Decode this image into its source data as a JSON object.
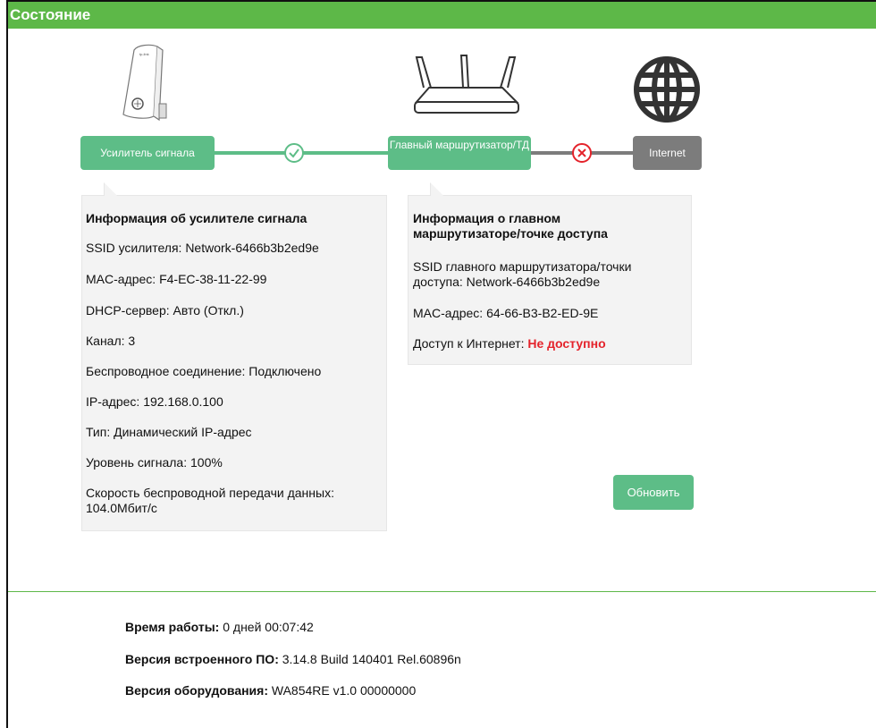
{
  "header": {
    "title": "Состояние"
  },
  "diagram": {
    "extender_label": "Усилитель сигнала",
    "router_label": "Главный маршрутизатор/ТД",
    "internet_label": "Internet",
    "link1_status_icon": "check-circle-icon",
    "link2_status_icon": "x-circle-icon",
    "colors": {
      "green": "#5dbd87",
      "gray": "#7c7c7c",
      "red": "#e4232b",
      "header": "#5db848"
    }
  },
  "extender": {
    "title": "Информация об усилителе сигнала",
    "ssid": "SSID усилителя: Network-6466b3b2ed9e",
    "mac": "MAC-адрес: F4-EC-38-11-22-99",
    "dhcp": "DHCP-сервер: Авто (Откл.)",
    "channel": "Канал: 3",
    "wireless": "Беспроводное соединение: Подключено",
    "ip": "IP-адрес: 192.168.0.100",
    "type": "Тип: Динамический IP-адрес",
    "signal": "Уровень сигнала: 100%",
    "speed_line1": "Скорость беспроводной передачи данных:",
    "speed_line2": "104.0Мбит/с"
  },
  "router": {
    "title_line1": "Информация о главном",
    "title_line2": "маршрутизаторе/точке доступа",
    "ssid_line1": "SSID главного маршрутизатора/точки",
    "ssid_line2": "доступа: Network-6466b3b2ed9e",
    "mac": "MAC-адрес: 64-66-B3-B2-ED-9E",
    "internet_label": "Доступ к Интернет: ",
    "internet_value": "Не доступно"
  },
  "refresh_label": "Обновить",
  "footer": {
    "uptime_label": "Время работы:",
    "uptime_value": " 0 дней 00:07:42",
    "firmware_label": "Версия встроенного ПО:",
    "firmware_value": " 3.14.8 Build 140401 Rel.60896n",
    "hardware_label": "Версия оборудования:",
    "hardware_value": " WA854RE v1.0 00000000"
  }
}
